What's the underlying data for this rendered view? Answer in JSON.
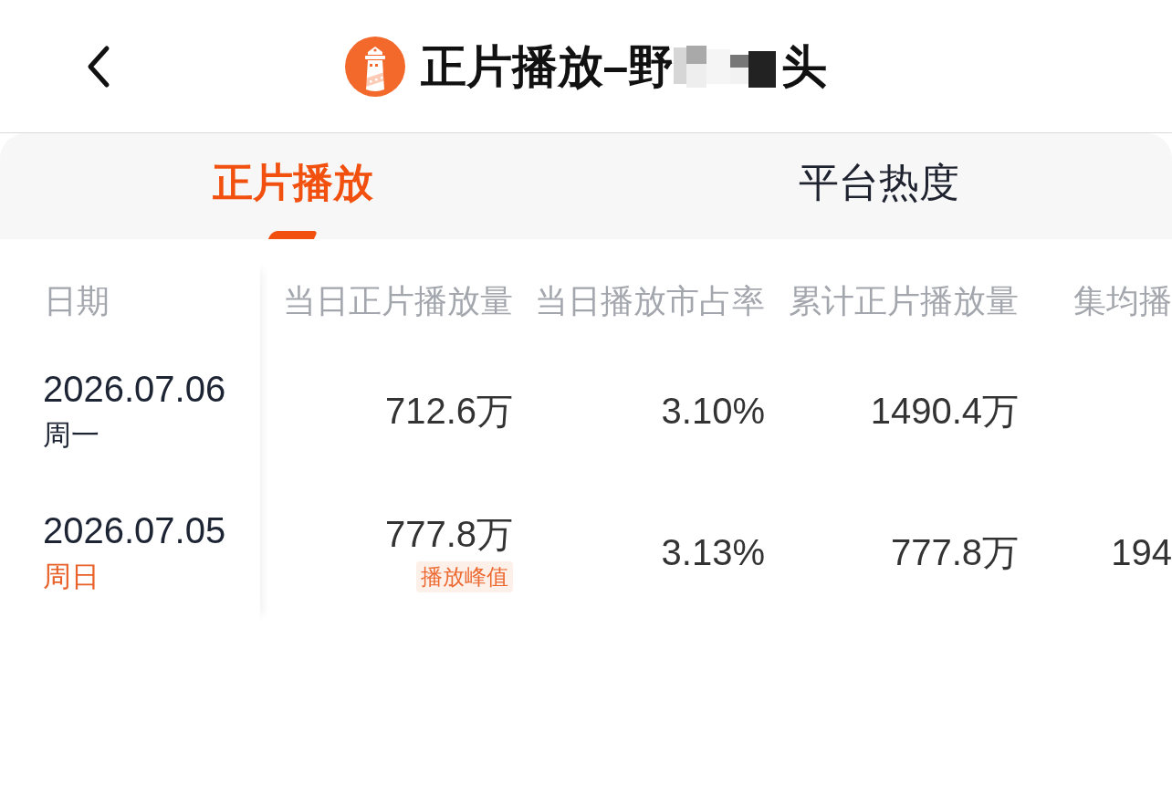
{
  "header": {
    "title_start": "正片播放–野",
    "title_end": "头"
  },
  "tabs": [
    {
      "label": "正片播放",
      "selected": true
    },
    {
      "label": "平台热度",
      "selected": false
    }
  ],
  "table": {
    "columns": [
      "日期",
      "当日正片播放量",
      "当日播放市占率",
      "累计正片播放量",
      "集均播"
    ],
    "rows": [
      {
        "cells": [
          {
            "value": "2026.07.06",
            "weekday": "周一",
            "weekend": false
          },
          {
            "value": "712.6万"
          },
          {
            "value": "3.10%"
          },
          {
            "value": "1490.4万"
          }
        ]
      },
      {
        "cells": [
          {
            "value": "2026.07.05",
            "weekday": "周日",
            "weekend": true
          },
          {
            "value": "777.8万",
            "badge": "播放峰值"
          },
          {
            "value": "3.13%"
          },
          {
            "value": "777.8万"
          },
          {
            "value": "194"
          }
        ]
      }
    ]
  }
}
